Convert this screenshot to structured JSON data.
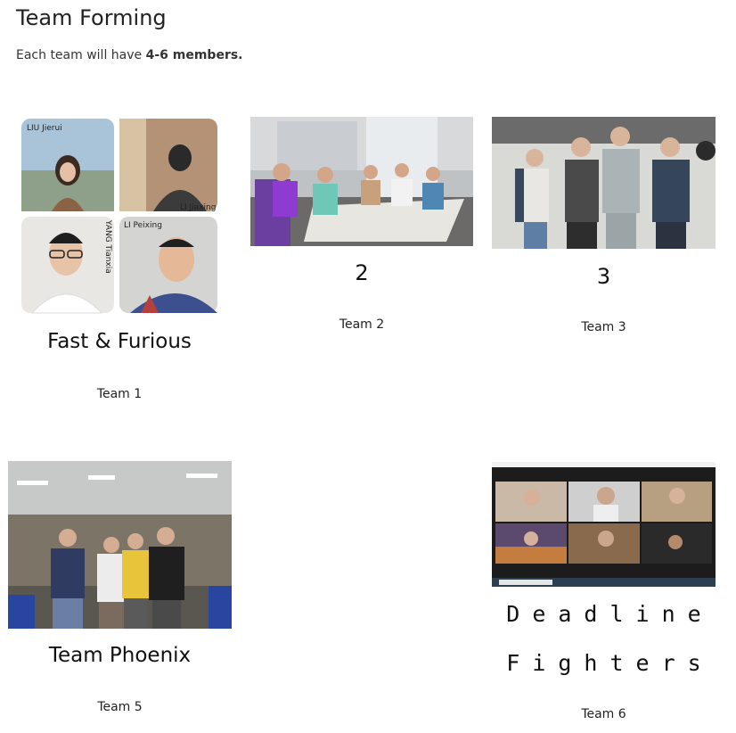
{
  "page": {
    "title": "Team Forming",
    "intro_prefix": "Each team will have ",
    "intro_bold": "4-6 members."
  },
  "teams": [
    {
      "team_name": "Fast & Furious",
      "team_label": "Team 1",
      "collage_names": [
        "LIU Jierui",
        "LI Jiaxing",
        "YANG Tianxia",
        "LI Peixing"
      ]
    },
    {
      "team_name": "2",
      "team_label": "Team 2"
    },
    {
      "team_name": "3",
      "team_label": "Team 3"
    },
    {
      "team_name": "Team Phoenix",
      "team_label": "Team 5"
    },
    {
      "team_name_line1": "Deadline",
      "team_name_line2": "Fighters",
      "team_label": "Team 6"
    }
  ]
}
